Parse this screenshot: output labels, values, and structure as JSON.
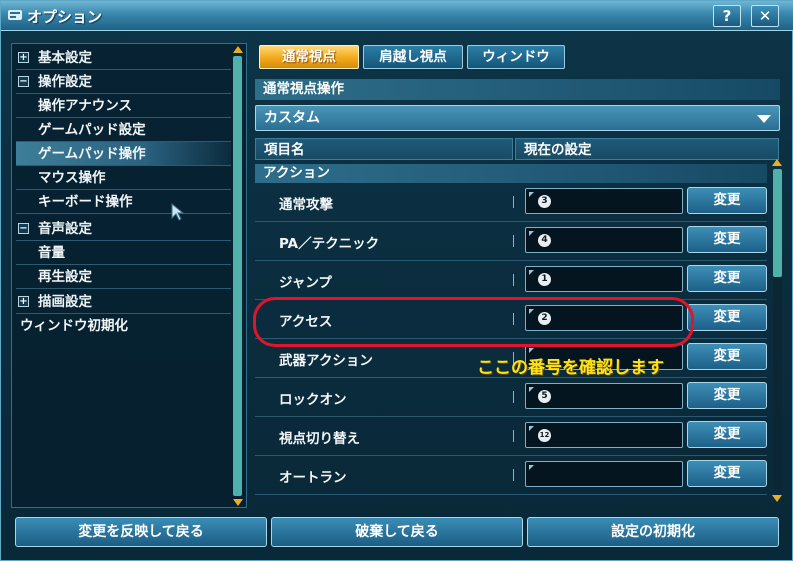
{
  "window": {
    "title": "オプション",
    "help_label": "?",
    "close_label": "✕"
  },
  "sidebar": {
    "items": [
      {
        "label": "基本設定",
        "type": "category",
        "toggle": "+"
      },
      {
        "label": "操作設定",
        "type": "category",
        "toggle": "−"
      },
      {
        "label": "操作アナウンス",
        "type": "item"
      },
      {
        "label": "ゲームパッド設定",
        "type": "item"
      },
      {
        "label": "ゲームパッド操作",
        "type": "item",
        "selected": true
      },
      {
        "label": "マウス操作",
        "type": "item"
      },
      {
        "label": "キーボード操作",
        "type": "item"
      },
      {
        "label": "音声設定",
        "type": "category",
        "toggle": "−"
      },
      {
        "label": "音量",
        "type": "item"
      },
      {
        "label": "再生設定",
        "type": "item"
      },
      {
        "label": "描画設定",
        "type": "category",
        "toggle": "+"
      },
      {
        "label": "ウィンドウ初期化",
        "type": "root"
      }
    ]
  },
  "tabs": [
    {
      "label": "通常視点",
      "active": true
    },
    {
      "label": "肩越し視点",
      "active": false
    },
    {
      "label": "ウィンドウ",
      "active": false
    }
  ],
  "section_title": "通常視点操作",
  "preset": {
    "selected": "カスタム"
  },
  "columns": {
    "item_name": "項目名",
    "current_setting": "現在の設定"
  },
  "group_label": "アクション",
  "rows": [
    {
      "label": "通常攻撃",
      "key": "3",
      "button": "変更"
    },
    {
      "label": "PA／テクニック",
      "key": "4",
      "button": "変更"
    },
    {
      "label": "ジャンプ",
      "key": "1",
      "button": "変更"
    },
    {
      "label": "アクセス",
      "key": "2",
      "button": "変更"
    },
    {
      "label": "武器アクション",
      "key": "",
      "button": "変更"
    },
    {
      "label": "ロックオン",
      "key": "5",
      "button": "変更"
    },
    {
      "label": "視点切り替え",
      "key": "12",
      "button": "変更"
    },
    {
      "label": "オートラン",
      "key": "",
      "button": "変更"
    }
  ],
  "annotation": "ここの番号を確認します",
  "footer": {
    "apply_label": "変更を反映して戻る",
    "discard_label": "破棄して戻る",
    "reset_label": "設定の初期化"
  },
  "colors": {
    "accent_tab": "#f2a91a",
    "highlight": "#e0142a",
    "annotation": "#ffe21a"
  }
}
